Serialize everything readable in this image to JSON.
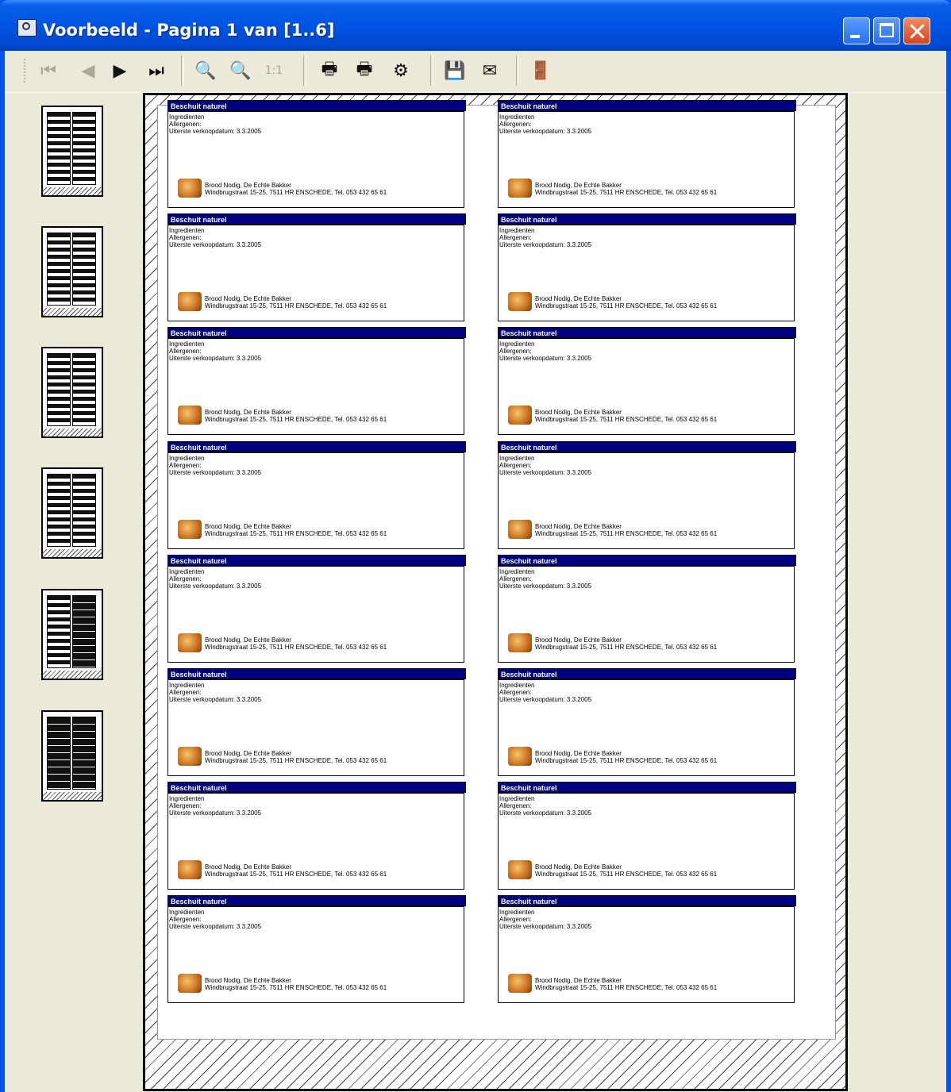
{
  "window": {
    "title": "Voorbeeld - Pagina 1 van [1..6]"
  },
  "toolbar": {
    "first_icon": "first-page-icon",
    "prev_icon": "previous-page-icon",
    "next_icon": "next-page-icon",
    "last_icon": "last-page-icon",
    "zoom_in_icon": "zoom-in-icon",
    "zoom_out_icon": "zoom-out-icon",
    "actual_size": "1:1",
    "print_icon": "print-icon",
    "print_setup_icon": "print-setup-icon",
    "printer_settings_icon": "printer-settings-icon",
    "save_icon": "save-icon",
    "email_icon": "email-icon",
    "exit_icon": "exit-icon"
  },
  "thumbnails": {
    "count": 6,
    "current": 1
  },
  "label": {
    "header": "Beschuit naturel",
    "line1": "Ingredienten",
    "line2": "Allergenen:",
    "line3": "Uiterste verkoopdatum: 3.3.2005",
    "footer1": "Brood Nodig, De Echte Bakker",
    "footer2": "Windbrugstraat 15-25, 7511 HR ENSCHEDE, Tel. 053 432 65 61"
  },
  "labels_on_page": 16
}
